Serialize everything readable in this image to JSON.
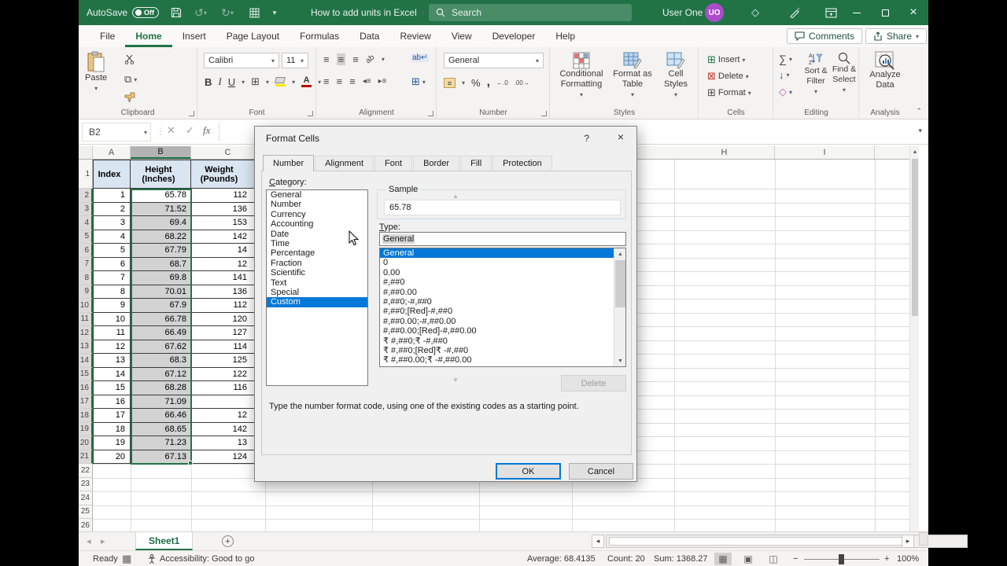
{
  "colors": {
    "accent_green": "#217346",
    "selection_blue": "#0078d7",
    "header_fill": "#d9e5f1",
    "selection_gray": "#d2d2d2",
    "avatar_purple": "#ab4ccb",
    "titlebar_green": "#217346"
  },
  "titlebar": {
    "autosave_label": "AutoSave",
    "autosave_state": "Off",
    "doc_title": "How to add units in Excel",
    "search_placeholder": "Search",
    "user_name": "User One",
    "user_initials": "UO"
  },
  "menubar": {
    "tabs": [
      "File",
      "Home",
      "Insert",
      "Page Layout",
      "Formulas",
      "Data",
      "Review",
      "View",
      "Developer",
      "Help"
    ],
    "active_tab": "Home",
    "comments_label": "Comments",
    "share_label": "Share"
  },
  "ribbon": {
    "clipboard": {
      "label": "Clipboard",
      "paste": "Paste"
    },
    "font": {
      "label": "Font",
      "font_name": "Calibri",
      "font_size": "11",
      "bold": "B",
      "italic": "I",
      "underline": "U"
    },
    "alignment": {
      "label": "Alignment"
    },
    "number": {
      "label": "Number",
      "format": "General",
      "percent": "%",
      "comma": ",",
      "inc_decimal": "←.0",
      "dec_decimal": ".00→"
    },
    "styles": {
      "label": "Styles",
      "conditional": "Conditional\nFormatting",
      "format_table": "Format as\nTable",
      "cell_styles": "Cell\nStyles"
    },
    "cells": {
      "label": "Cells",
      "insert": "Insert",
      "delete": "Delete",
      "format": "Format"
    },
    "editing": {
      "label": "Editing",
      "sum": "∑",
      "sort": "Sort &\nFilter",
      "find": "Find &\nSelect"
    },
    "analysis": {
      "label": "Analysis",
      "analyze": "Analyze\nData"
    }
  },
  "formula_bar": {
    "name_box": "B2",
    "fx": "fx"
  },
  "sheet": {
    "cols_left": [
      "A",
      "B",
      "C"
    ],
    "cols_right": [
      "H",
      "I"
    ],
    "selected_column": "B",
    "row_count": 26,
    "header": [
      "Index",
      "Height\n(Inches)",
      "Weight\n(Pounds)"
    ],
    "rows": [
      {
        "i": "1",
        "h": "65.78",
        "w": "112"
      },
      {
        "i": "2",
        "h": "71.52",
        "w": "136"
      },
      {
        "i": "3",
        "h": "69.4",
        "w": "153"
      },
      {
        "i": "4",
        "h": "68.22",
        "w": "142"
      },
      {
        "i": "5",
        "h": "67.79",
        "w": "14"
      },
      {
        "i": "6",
        "h": "68.7",
        "w": "12"
      },
      {
        "i": "7",
        "h": "69.8",
        "w": "141"
      },
      {
        "i": "8",
        "h": "70.01",
        "w": "136"
      },
      {
        "i": "9",
        "h": "67.9",
        "w": "112"
      },
      {
        "i": "10",
        "h": "66.78",
        "w": "120"
      },
      {
        "i": "11",
        "h": "66.49",
        "w": "127"
      },
      {
        "i": "12",
        "h": "67.62",
        "w": "114"
      },
      {
        "i": "13",
        "h": "68.3",
        "w": "125"
      },
      {
        "i": "14",
        "h": "67.12",
        "w": "122"
      },
      {
        "i": "15",
        "h": "68.28",
        "w": "116"
      },
      {
        "i": "16",
        "h": "71.09",
        "w": ""
      },
      {
        "i": "17",
        "h": "66.46",
        "w": "12"
      },
      {
        "i": "18",
        "h": "68.65",
        "w": "142"
      },
      {
        "i": "19",
        "h": "71.23",
        "w": "13"
      },
      {
        "i": "20",
        "h": "67.13",
        "w": "124"
      }
    ]
  },
  "sheet_tabs": {
    "active_sheet": "Sheet1"
  },
  "status_bar": {
    "mode": "Ready",
    "accessibility": "Accessibility: Good to go",
    "average": "Average: 68.4135",
    "count": "Count: 20",
    "sum": "Sum: 1368.27",
    "zoom": "100%"
  },
  "dialog": {
    "title": "Format Cells",
    "help": "?",
    "tabs": [
      "Number",
      "Alignment",
      "Font",
      "Border",
      "Fill",
      "Protection"
    ],
    "active_tab": "Number",
    "category_label": "Category:",
    "categories": [
      "General",
      "Number",
      "Currency",
      "Accounting",
      "Date",
      "Time",
      "Percentage",
      "Fraction",
      "Scientific",
      "Text",
      "Special",
      "Custom"
    ],
    "selected_category": "Custom",
    "sample_label": "Sample",
    "sample_value": "65.78",
    "type_label": "Type:",
    "type_value": "General",
    "type_options": [
      "General",
      "0",
      "0.00",
      "#,##0",
      "#,##0.00",
      "#,##0;-#,##0",
      "#,##0;[Red]-#,##0",
      "#,##0.00;-#,##0.00",
      "#,##0.00;[Red]-#,##0.00",
      "₹ #,##0;₹ -#,##0",
      "₹ #,##0;[Red]₹ -#,##0",
      "₹ #,##0.00;₹ -#,##0.00"
    ],
    "selected_type_option": "General",
    "delete_label": "Delete",
    "helper_text": "Type the number format code, using one of the existing codes as a starting point.",
    "ok_label": "OK",
    "cancel_label": "Cancel"
  }
}
